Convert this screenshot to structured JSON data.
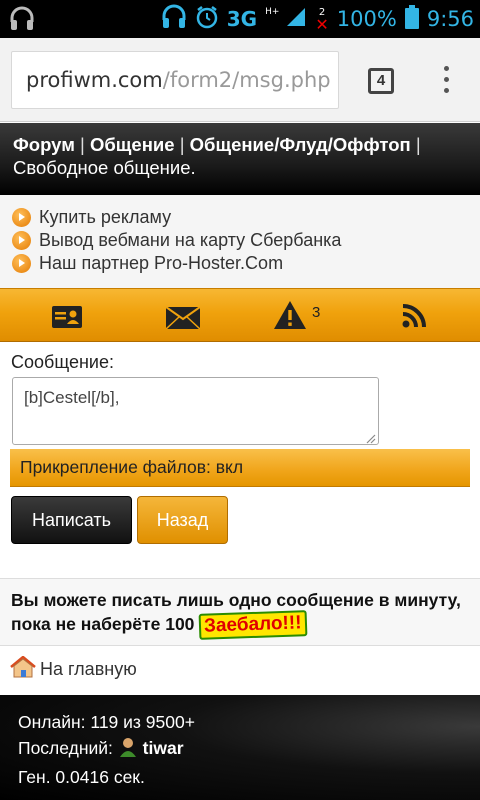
{
  "status_bar": {
    "network": "3G",
    "network_sup": "H+",
    "sim_indicator": "2",
    "battery": "100%",
    "time": "9:56",
    "icons": [
      "headphones-icon",
      "alarm-icon",
      "signal-icon",
      "battery-icon"
    ]
  },
  "browser": {
    "url_domain": "profiwm.com",
    "url_path": "/form2/msg.php",
    "tab_count": "4"
  },
  "breadcrumb": {
    "items": [
      "Форум",
      "Общение",
      "Общение/Флуд/Оффтоп",
      "Свободное общение."
    ],
    "separator": "|"
  },
  "ad_links": [
    "Купить рекламу",
    "Вывод вебмани на карту Сбербанка",
    "Наш партнер Pro-Hoster.Com"
  ],
  "nav": {
    "icons": [
      "contact-card-icon",
      "mail-icon",
      "warning-icon",
      "rss-icon"
    ],
    "alerts_count": "3"
  },
  "form": {
    "label": "Сообщение:",
    "message_value": "[b]Cestel[/b],",
    "attach_text": "Прикрепление файлов: вкл",
    "send_label": "Написать",
    "back_label": "Назад"
  },
  "notice": {
    "text": "Вы можете писать лишь одно сообщение в минуту, пока не наберёте 100",
    "smiley_text": "Заебало!!!"
  },
  "home_link": "На главную",
  "footer": {
    "online": "Онлайн: 119 из 9500+",
    "last_label": "Последний:",
    "last_user": "tiwar",
    "gen": "Ген. 0.0416 сек."
  },
  "colors": {
    "accent_orange": "#f0a20d",
    "status_blue": "#33b5e5",
    "header_dark": "#1a1a1a"
  }
}
